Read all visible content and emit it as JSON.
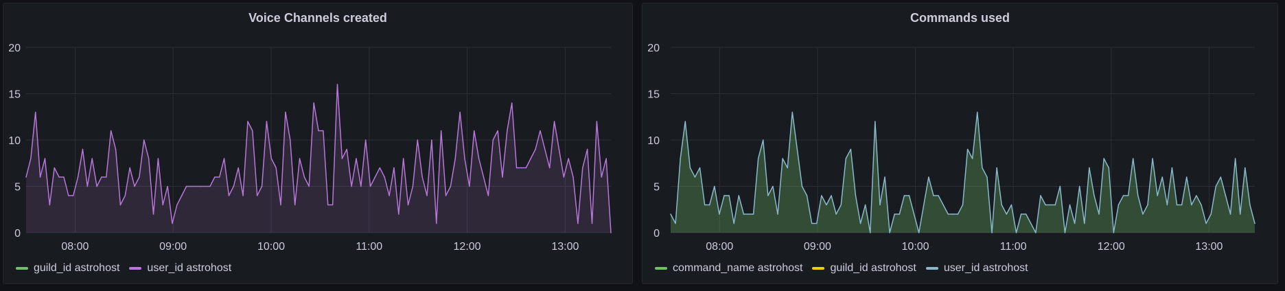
{
  "chart_data": [
    {
      "type": "area",
      "title": "Voice Channels created",
      "ylim": [
        0,
        20
      ],
      "yticks": [
        "0",
        "5",
        "10",
        "15",
        "20"
      ],
      "xtick_labels": [
        "08:00",
        "09:00",
        "10:00",
        "11:00",
        "12:00",
        "13:00"
      ],
      "x_range_minutes": [
        450,
        808
      ],
      "grid": true,
      "legend_placement": "bottom-left",
      "series": [
        {
          "name": "guild_id astrohost",
          "color": "#73bf69",
          "values": []
        },
        {
          "name": "user_id astrohost",
          "color": "#b877d9",
          "values": [
            6,
            8,
            13,
            6,
            8,
            3,
            7,
            6,
            6,
            4,
            4,
            6,
            9,
            5,
            8,
            5,
            6,
            6,
            11,
            9,
            3,
            4,
            7,
            5,
            6,
            10,
            8,
            2,
            8,
            3,
            5,
            1,
            3,
            4,
            5,
            5,
            5,
            5,
            5,
            5,
            6,
            6,
            8,
            4,
            5,
            7,
            4,
            12,
            11,
            4,
            5,
            12,
            8,
            7,
            3,
            13,
            10,
            3,
            8,
            6,
            5,
            14,
            11,
            11,
            3,
            3,
            16,
            8,
            9,
            5,
            8,
            5,
            10,
            5,
            6,
            7,
            6,
            4,
            7,
            2,
            8,
            3,
            5,
            10,
            6,
            4,
            10,
            1,
            11,
            4,
            5,
            8,
            13,
            8,
            5,
            11,
            8,
            6,
            4,
            10,
            11,
            6,
            11,
            14,
            7,
            7,
            7,
            8,
            9,
            11,
            9,
            7,
            12,
            9,
            6,
            8,
            6,
            1,
            7,
            9,
            1,
            12,
            6,
            8,
            0
          ]
        }
      ]
    },
    {
      "type": "area",
      "title": "Commands used",
      "ylim": [
        0,
        20
      ],
      "yticks": [
        "0",
        "5",
        "10",
        "15",
        "20"
      ],
      "xtick_labels": [
        "08:00",
        "09:00",
        "10:00",
        "11:00",
        "12:00",
        "13:00"
      ],
      "x_range_minutes": [
        450,
        808
      ],
      "grid": true,
      "legend_placement": "bottom-left",
      "series": [
        {
          "name": "command_name astrohost",
          "color": "#73bf69",
          "values": []
        },
        {
          "name": "guild_id astrohost",
          "color": "#f2cc0c",
          "values": []
        },
        {
          "name": "user_id astrohost",
          "color": "#8ab8cc",
          "values": [
            2,
            1,
            8,
            12,
            7,
            6,
            7,
            3,
            3,
            5,
            2,
            4,
            4,
            1,
            4,
            2,
            2,
            2,
            8,
            10,
            4,
            5,
            2,
            8,
            7,
            13,
            9,
            5,
            4,
            1,
            1,
            4,
            3,
            4,
            2,
            3,
            8,
            9,
            4,
            1,
            3,
            0,
            12,
            3,
            6,
            0,
            2,
            2,
            4,
            4,
            2,
            0,
            3,
            6,
            4,
            4,
            3,
            2,
            2,
            2,
            3,
            9,
            8,
            13,
            7,
            6,
            0,
            7,
            3,
            2,
            3,
            0,
            2,
            2,
            1,
            0,
            4,
            3,
            3,
            3,
            5,
            0,
            3,
            1,
            5,
            1,
            7,
            4,
            2,
            8,
            7,
            0,
            3,
            4,
            4,
            8,
            4,
            2,
            3,
            8,
            4,
            6,
            3,
            7,
            3,
            3,
            6,
            3,
            4,
            3,
            1,
            2,
            5,
            6,
            4,
            2,
            8,
            2,
            7,
            3,
            1
          ]
        }
      ]
    }
  ]
}
